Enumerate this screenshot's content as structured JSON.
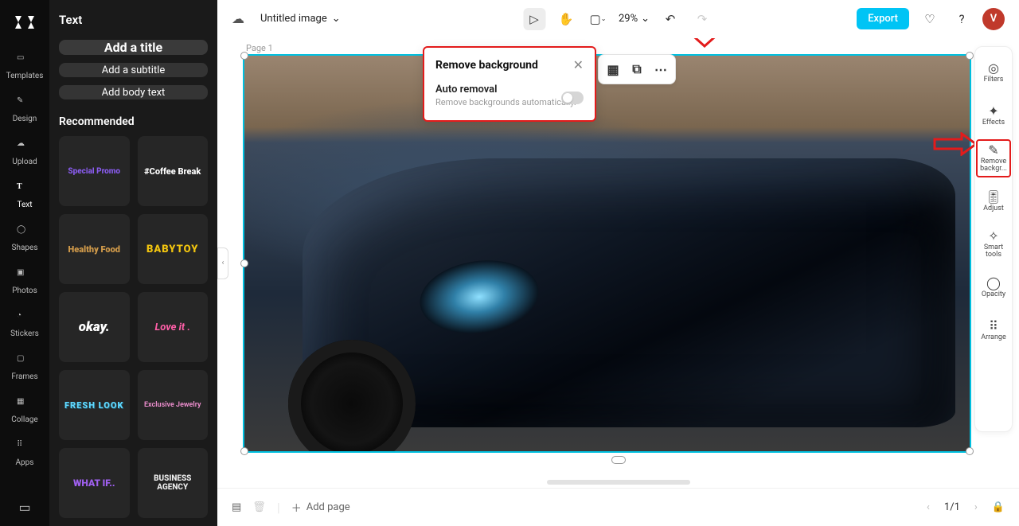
{
  "nav": [
    {
      "label": "Templates"
    },
    {
      "label": "Design"
    },
    {
      "label": "Upload"
    },
    {
      "label": "Text"
    },
    {
      "label": "Shapes"
    },
    {
      "label": "Photos"
    },
    {
      "label": "Stickers"
    },
    {
      "label": "Frames"
    },
    {
      "label": "Collage"
    },
    {
      "label": "Apps"
    }
  ],
  "leftPanel": {
    "heading": "Text",
    "addTitle": "Add a title",
    "addSubtitle": "Add a subtitle",
    "addBody": "Add body text",
    "recommended": "Recommended",
    "presets": [
      "Special Promo",
      "#Coffee Break",
      "Healthy Food",
      "BABYTOY",
      "okay.",
      "Love it .",
      "FRESH LOOK",
      "Exclusive Jewelry",
      "WHAT IF..",
      "BUSINESS AGENCY"
    ]
  },
  "topbar": {
    "docTitle": "Untitled image",
    "zoom": "29%",
    "export": "Export",
    "avatar": "V"
  },
  "canvas": {
    "pageLabel": "Page 1"
  },
  "popup": {
    "title": "Remove background",
    "subtitle": "Auto removal",
    "desc": "Remove backgrounds automatically."
  },
  "rightRail": [
    {
      "label": "Filters"
    },
    {
      "label": "Effects"
    },
    {
      "label": "Remove backgr..."
    },
    {
      "label": "Adjust"
    },
    {
      "label": "Smart tools"
    },
    {
      "label": "Opacity"
    },
    {
      "label": "Arrange"
    }
  ],
  "bottom": {
    "addPage": "Add page",
    "page": "1/1"
  }
}
